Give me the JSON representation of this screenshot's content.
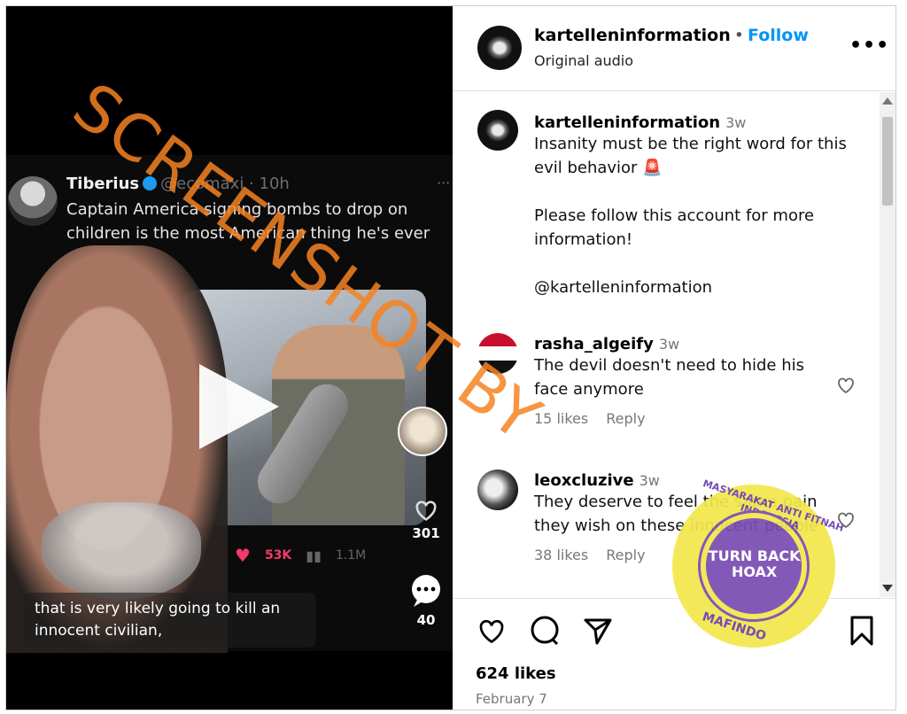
{
  "colors": {
    "follow": "#0095f6",
    "tiktok_heart": "#f5396b",
    "watermark": "#f48222",
    "stamp_yellow": "#f3e84c",
    "stamp_purple": "#7a4db3"
  },
  "video": {
    "tweet": {
      "name": "Tiberius",
      "handle": "@ecomaxi",
      "time": "10h",
      "text": "Captain America signing bombs to drop on children is the most American thing he's ever"
    },
    "stats": {
      "likes": "53K",
      "views": "1.1M"
    },
    "side": {
      "bookmarks": "301",
      "comments": "40"
    },
    "caption": "that is very likely going to kill an innocent civilian,",
    "watermark": "SCREENSHOT BY"
  },
  "header": {
    "username": "kartelleninformation",
    "separator": "•",
    "follow_label": "Follow",
    "audio": "Original audio",
    "more_icon": "more-icon"
  },
  "comments": [
    {
      "username": "kartelleninformation",
      "time": "3w",
      "lines": [
        "Insanity must be the right word for this evil behavior 🚨",
        "",
        "Please follow this account for more information!",
        "",
        "@kartelleninformation"
      ]
    },
    {
      "username": "rasha_algeify",
      "time": "3w",
      "text": "The devil doesn't need to hide his face anymore",
      "likes": "15 likes",
      "reply": "Reply"
    },
    {
      "username": "leoxcluzive",
      "time": "3w",
      "text": "They deserve to feel the same pain they wish on these innocent people",
      "likes": "38 likes",
      "reply": "Reply"
    }
  ],
  "footer": {
    "likes": "624 likes",
    "date": "February 7"
  },
  "stamp": {
    "center": "TURN BACK HOAX",
    "ring_top": "MASYARAKAT ANTI FITNAH INDONESIA",
    "ring_bottom": "MAFINDO"
  }
}
